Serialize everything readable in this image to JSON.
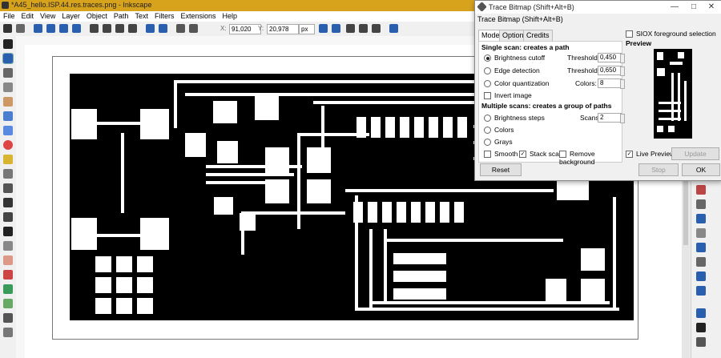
{
  "window": {
    "title": "*A45_hello.ISP.44.res.traces.png - Inkscape"
  },
  "menu": [
    "File",
    "Edit",
    "View",
    "Layer",
    "Object",
    "Path",
    "Text",
    "Filters",
    "Extensions",
    "Help"
  ],
  "toolbar": {
    "x_label": "X:",
    "x_value": "91,020",
    "y_label": "Y:",
    "y_value": "20,978",
    "unit": "px"
  },
  "dialog": {
    "title": "Trace Bitmap (Shift+Alt+B)",
    "subtitle": "Trace Bitmap (Shift+Alt+B)",
    "tabs": [
      "Mode",
      "Options",
      "Credits"
    ],
    "active_tab": "Mode",
    "single_scan_header": "Single scan: creates a path",
    "brightness_cutoff": "Brightness cutoff",
    "threshold_label": "Threshold:",
    "brightness_threshold": "0,450",
    "edge_detection": "Edge detection",
    "edge_threshold": "0,650",
    "color_quantization": "Color quantization",
    "colors_label": "Colors:",
    "colors_value": "8",
    "invert_image": "Invert image",
    "multiple_scans_header": "Multiple scans: creates a group of paths",
    "brightness_steps": "Brightness steps",
    "scans_label": "Scans:",
    "scans_value": "2",
    "colors_option": "Colors",
    "grays_option": "Grays",
    "smooth": "Smooth",
    "stack_scans": "Stack scans",
    "remove_background": "Remove background",
    "siox": "SIOX foreground selection",
    "preview_header": "Preview",
    "live_preview": "Live Preview",
    "update_button": "Update",
    "reset_button": "Reset",
    "stop_button": "Stop",
    "ok_button": "OK"
  },
  "colors": {
    "titlebar": "#d8a31c",
    "trace_bg": "#000000",
    "pad": "#ffffff"
  }
}
